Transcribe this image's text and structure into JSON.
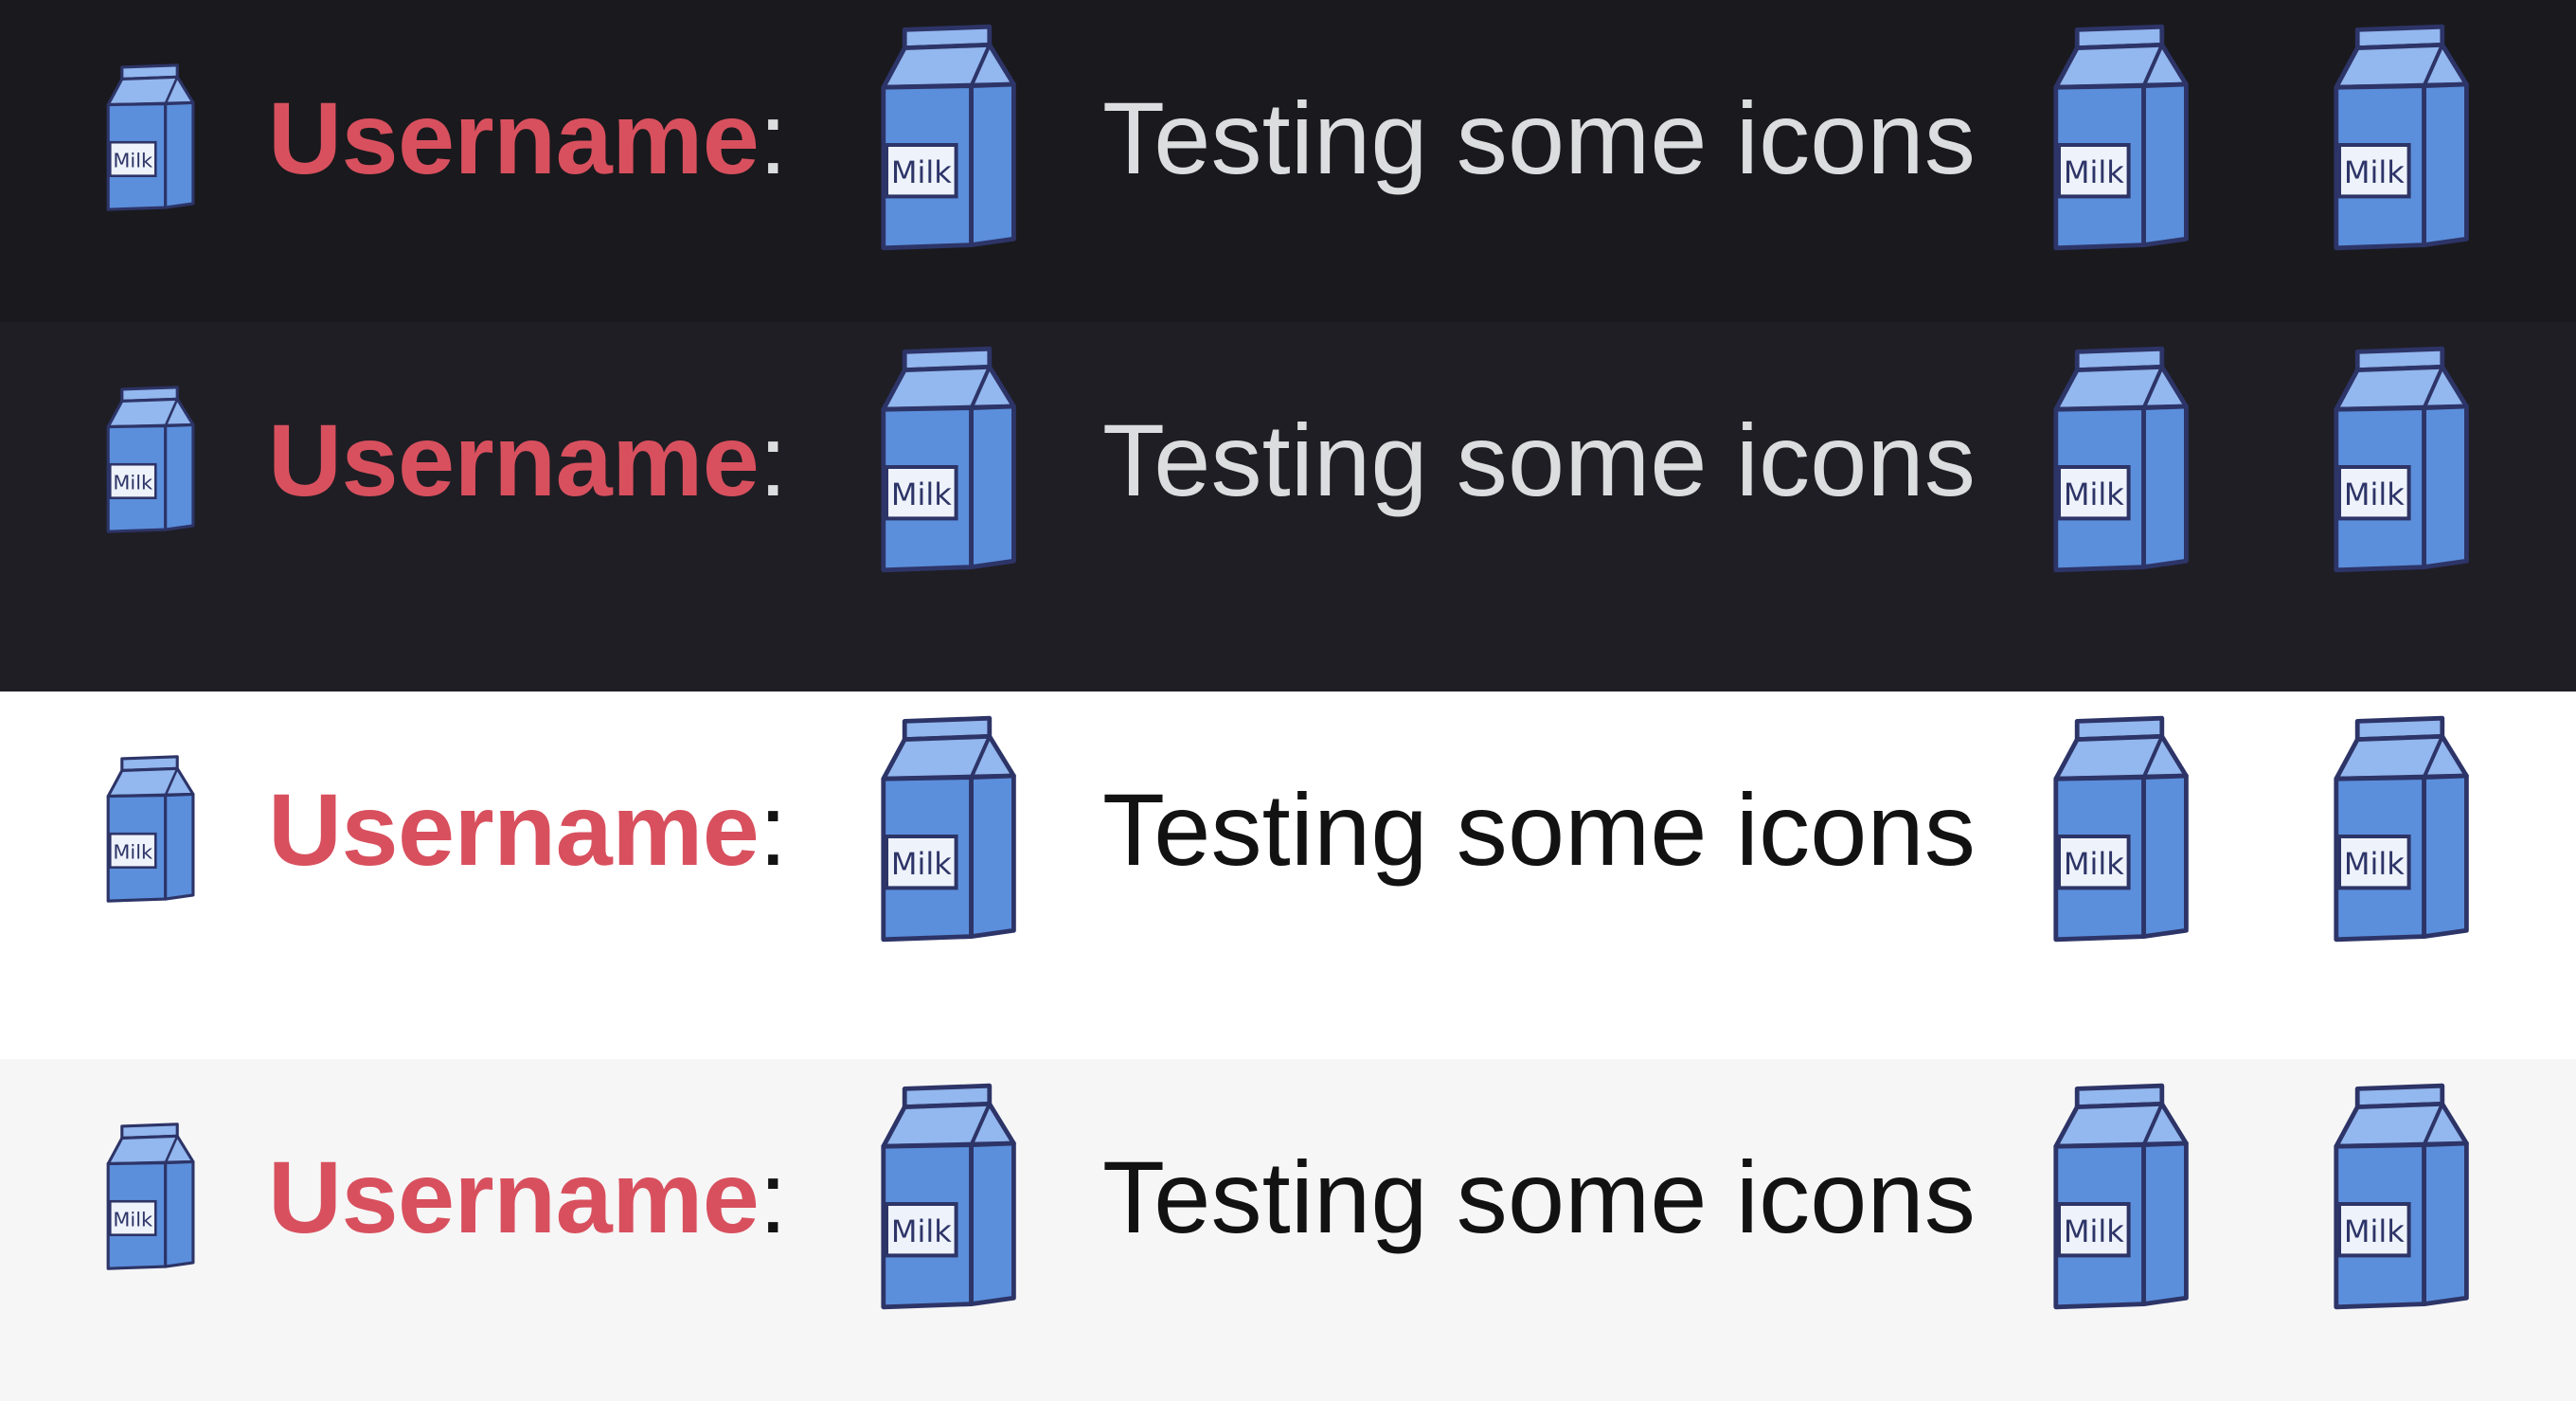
{
  "colors": {
    "username": "#d8505e",
    "carton_fill": "#5b8fdc",
    "carton_light": "#93b7ef",
    "carton_outline": "#2d3467",
    "label_fill": "#eef2fa",
    "label_text": "#2d3467"
  },
  "icons": {
    "avatar": "milk-carton-icon",
    "emoji": "milk-carton-icon"
  },
  "rows": [
    {
      "theme": "dark",
      "background": "#1a191d",
      "text_color": "#dcddde",
      "username": "Username",
      "colon": ":",
      "message": "Testing some icons",
      "carton_label": "Milk"
    },
    {
      "theme": "darker",
      "background": "#1f1e24",
      "text_color": "#dcddde",
      "username": "Username",
      "colon": ":",
      "message": "Testing some icons",
      "carton_label": "Milk"
    },
    {
      "theme": "light",
      "background": "#ffffff",
      "text_color": "#121212",
      "username": "Username",
      "colon": ":",
      "message": "Testing some icons",
      "carton_label": "Milk"
    },
    {
      "theme": "light-gray",
      "background": "#f6f6f6",
      "text_color": "#121212",
      "username": "Username",
      "colon": ":",
      "message": "Testing some icons",
      "carton_label": "Milk"
    }
  ]
}
